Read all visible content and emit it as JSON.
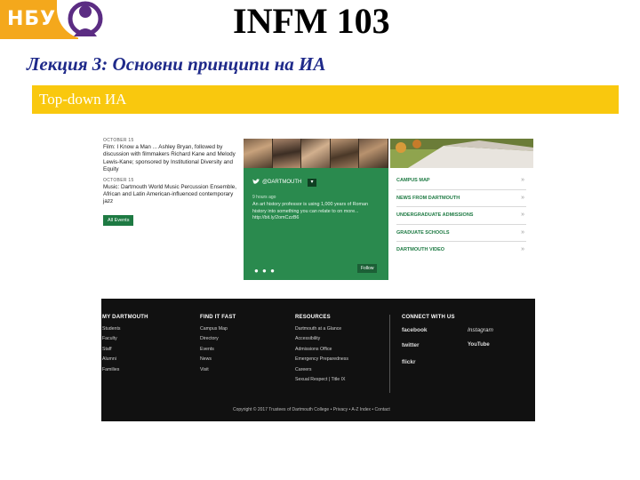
{
  "slide": {
    "logo_text": "НБУ",
    "title": "INFM 103",
    "lecture": "Лекция 3: Основни принципи на ИА",
    "band": "Top-down ИА"
  },
  "events": {
    "items": [
      {
        "date": "OCTOBER 15",
        "text": "Film: I Know a Man ... Ashley Bryan, followed by discussion with filmmakers Richard Kane and Melody Lewis-Kane; sponsored by Institutional Diversity and Equity"
      },
      {
        "date": "OCTOBER 15",
        "text": "Music: Dartmouth World Music Percussion Ensemble, African and Latin American-influenced contemporary jazz"
      }
    ],
    "all_events": "All Events"
  },
  "twitter": {
    "handle": "@DARTMOUTH",
    "time": "9 hours ago",
    "body": "An art history professor is using 1,000 years of Roman history into something you can relate to on more... http://bit.ly/2omCzzB6",
    "follow": "Follow"
  },
  "links": [
    "CAMPUS MAP",
    "NEWS FROM DARTMOUTH",
    "UNDERGRADUATE ADMISSIONS",
    "GRADUATE SCHOOLS",
    "DARTMOUTH VIDEO"
  ],
  "footer": {
    "columns": [
      {
        "heading": "MY DARTMOUTH",
        "items": [
          "Students",
          "Faculty",
          "Staff",
          "Alumni",
          "Families"
        ]
      },
      {
        "heading": "FIND IT FAST",
        "items": [
          "Campus Map",
          "Directory",
          "Events",
          "News",
          "Visit"
        ]
      },
      {
        "heading": "RESOURCES",
        "items": [
          "Dartmouth at a Glance",
          "Accessibility",
          "Admissions Office",
          "Emergency Preparedness",
          "Careers",
          "Sexual Respect | Title IX"
        ]
      }
    ],
    "connect_heading": "CONNECT WITH US",
    "social": [
      "facebook",
      "Instagram",
      "twitter",
      "YouTube",
      "flickr"
    ],
    "copyright": "Copyright © 2017 Trustees of Dartmouth College • Privacy • A-Z Index • Contact"
  },
  "colors": {
    "accent_orange": "#f4a81c",
    "band_yellow": "#f9c80e",
    "dartmouth_green": "#1e7a43",
    "emblem_purple": "#5b2c83"
  }
}
